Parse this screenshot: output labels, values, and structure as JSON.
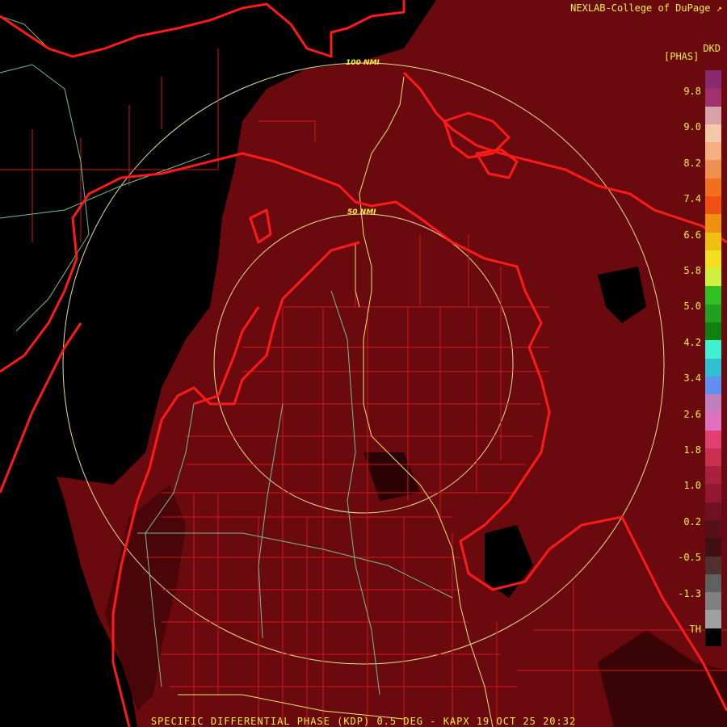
{
  "brand": "NEXLAB-College of DuPage",
  "product_code": "DKD",
  "unit_label": "[PHAS]",
  "caption": "SPECIFIC DIFFERENTIAL PHASE (KDP) 0.5 DEG - KAPX 19 OCT 25 20:32",
  "ring_labels": {
    "inner": "50 NMI",
    "outer": "100 NMI"
  },
  "legend_ticks": [
    "9.8",
    "9.0",
    "8.2",
    "7.4",
    "6.6",
    "5.8",
    "5.0",
    "4.2",
    "3.4",
    "2.6",
    "1.8",
    "1.0",
    "0.2",
    "-0.5",
    "-1.3",
    "TH"
  ],
  "legend_colors": [
    "#8a2a6e",
    "#a0306e",
    "#d8a0a8",
    "#f4c8a8",
    "#f4b080",
    "#f09050",
    "#f07020",
    "#f05010",
    "#f09010",
    "#f0c010",
    "#f0e020",
    "#d0f040",
    "#30c020",
    "#20a020",
    "#108010",
    "#40f0d0",
    "#30c0d0",
    "#6090f0",
    "#c080c0",
    "#e070c0",
    "#e04070",
    "#c83050",
    "#a82040",
    "#901830",
    "#701020",
    "#581018",
    "#401010",
    "#503030",
    "#606060",
    "#808080",
    "#a0a0a0",
    "#000000"
  ],
  "colors": {
    "background": "#000000",
    "echo": "#6a0a0f",
    "echo_dark": "#4a0508",
    "state_lines": "#ff1a1a",
    "county_lines": "#d01818",
    "highways": "#e8e870",
    "roads": "#70c090",
    "rings": "#e8e090",
    "text": "#f0f040"
  }
}
